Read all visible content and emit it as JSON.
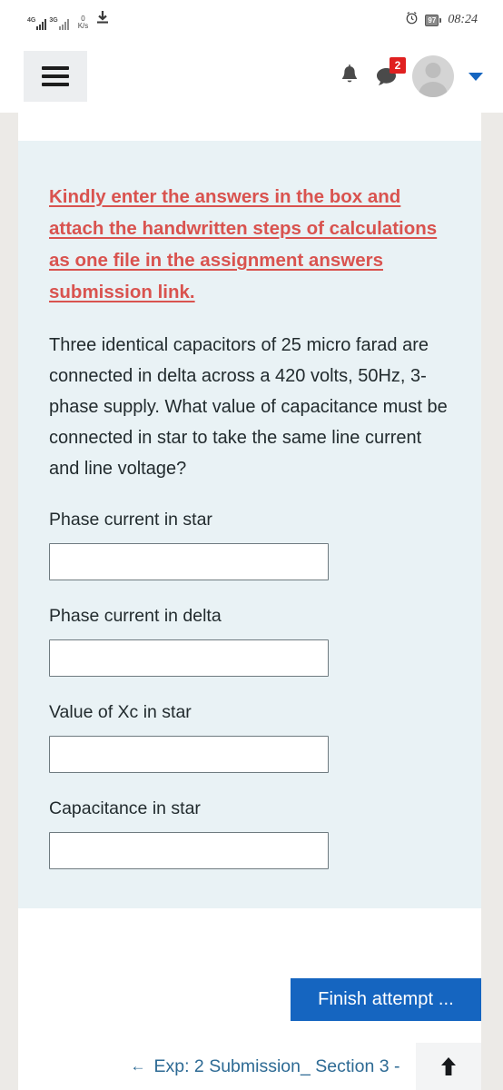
{
  "statusbar": {
    "network_primary": "4G",
    "network_secondary": "3G",
    "data_rate_value": "0",
    "data_rate_unit": "K/s",
    "download_icon": "download-icon",
    "alarm_icon": "alarm-clock-icon",
    "battery_level": "97",
    "time": "08:24"
  },
  "appbar": {
    "menu_icon": "hamburger-menu-icon",
    "bell_icon": "notification-bell-icon",
    "messages_icon": "messages-icon",
    "messages_badge": "2",
    "avatar": "user-avatar",
    "caret_icon": "chevron-down-icon"
  },
  "question": {
    "notice": "Kindly enter the answers in the box and attach the handwritten steps of calculations as one file in the assignment answers submission link.",
    "text": "Three identical capacitors of 25 micro farad  are connected in delta across a 420 volts, 50Hz, 3-phase supply. What value of capacitance must be connected in star to take the same line current and line voltage?",
    "fields": [
      {
        "label": "Phase current in star",
        "value": "",
        "placeholder": ""
      },
      {
        "label": "Phase current in delta",
        "value": "",
        "placeholder": ""
      },
      {
        "label": "Value of Xc in star",
        "value": "",
        "placeholder": ""
      },
      {
        "label": "Capacitance in star",
        "value": "",
        "placeholder": ""
      }
    ]
  },
  "actions": {
    "finish_label": "Finish attempt ..."
  },
  "bottombar": {
    "prev_arrow": "←",
    "prev_label": "Exp: 2 Submission_ Section 3 -",
    "to_top_icon": "arrow-up-icon"
  },
  "colors": {
    "notice_red": "#d9534f",
    "button_blue": "#1565c0",
    "card_bg": "#e9f2f5",
    "badge_red": "#e02020",
    "link_blue": "#2d6a94"
  }
}
